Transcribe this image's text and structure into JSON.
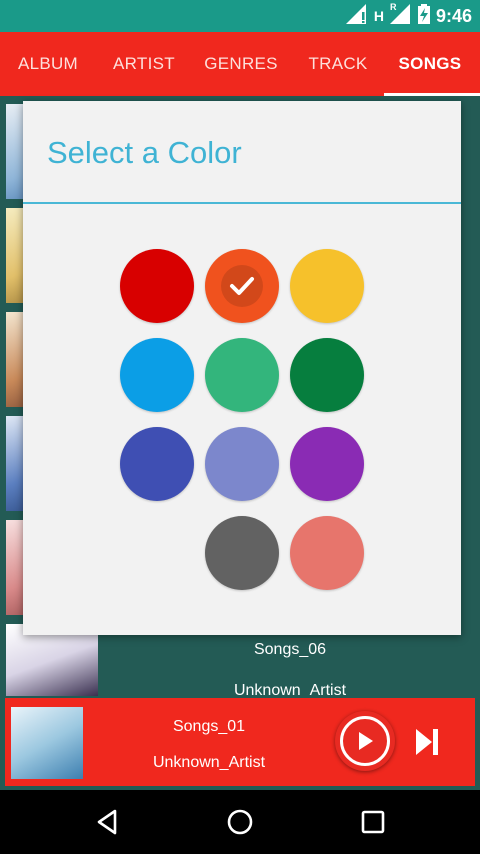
{
  "status_bar": {
    "time": "9:46",
    "network_label": "H",
    "roaming_label": "R",
    "icons": [
      "signal-icon",
      "signal-roaming-icon",
      "battery-charging-icon"
    ]
  },
  "tabs": [
    {
      "label": "ALBUM",
      "active": false
    },
    {
      "label": "ARTIST",
      "active": false
    },
    {
      "label": "GENRES",
      "active": false
    },
    {
      "label": "TRACK",
      "active": false
    },
    {
      "label": "SONGS",
      "active": true
    }
  ],
  "background_list": {
    "visible_item": {
      "title": "Songs_06",
      "artist": "Unknown_Artist"
    }
  },
  "dialog": {
    "title": "Select a Color",
    "accent_color": "#3fb3d4",
    "swatches": [
      {
        "name": "red",
        "color": "#d80000",
        "selected": false
      },
      {
        "name": "deep-orange",
        "color": "#f0521e",
        "selected": true
      },
      {
        "name": "amber",
        "color": "#f6c12b",
        "selected": false
      },
      {
        "name": "light-blue",
        "color": "#0b9ee6",
        "selected": false
      },
      {
        "name": "green",
        "color": "#33b57c",
        "selected": false
      },
      {
        "name": "dark-green",
        "color": "#067e3e",
        "selected": false
      },
      {
        "name": "indigo",
        "color": "#3f4fb3",
        "selected": false
      },
      {
        "name": "periwinkle",
        "color": "#7c87cc",
        "selected": false
      },
      {
        "name": "purple",
        "color": "#8a2bb4",
        "selected": false
      },
      {
        "name": "gray",
        "color": "#626262",
        "selected": false
      },
      {
        "name": "salmon",
        "color": "#e7756c",
        "selected": false
      }
    ]
  },
  "player": {
    "title": "Songs_01",
    "artist": "Unknown_Artist",
    "bar_color": "#f0281e"
  },
  "nav": {
    "buttons": [
      "back-icon",
      "home-icon",
      "recents-icon"
    ]
  }
}
